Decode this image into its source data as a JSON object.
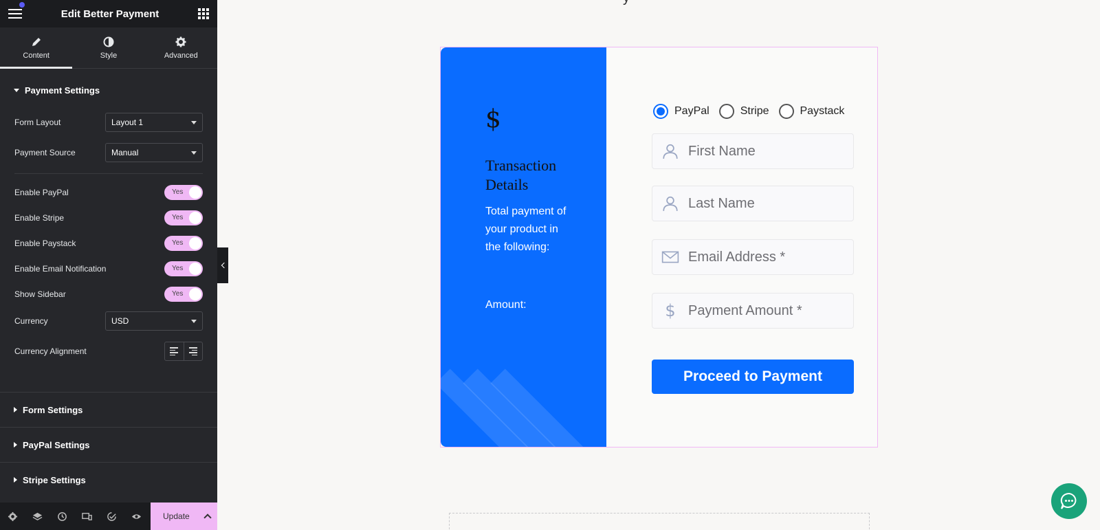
{
  "sidebar": {
    "title": "Edit Better Payment",
    "tabs": [
      {
        "label": "Content",
        "icon": "pencil-icon"
      },
      {
        "label": "Style",
        "icon": "half-circle-icon"
      },
      {
        "label": "Advanced",
        "icon": "gear-icon"
      }
    ],
    "payment_settings": {
      "heading": "Payment Settings",
      "form_layout": {
        "label": "Form Layout",
        "value": "Layout 1"
      },
      "payment_source": {
        "label": "Payment Source",
        "value": "Manual"
      },
      "toggles": [
        {
          "label": "Enable PayPal",
          "state": "Yes"
        },
        {
          "label": "Enable Stripe",
          "state": "Yes"
        },
        {
          "label": "Enable Paystack",
          "state": "Yes"
        },
        {
          "label": "Enable Email Notification",
          "state": "Yes"
        },
        {
          "label": "Show Sidebar",
          "state": "Yes"
        }
      ],
      "currency": {
        "label": "Currency",
        "value": "USD"
      },
      "currency_alignment": {
        "label": "Currency Alignment"
      }
    },
    "sections": [
      "Form Settings",
      "PayPal Settings",
      "Stripe Settings"
    ],
    "footer": {
      "icons": [
        "settings-icon",
        "layers-icon",
        "history-icon",
        "responsive-icon",
        "checklist-icon",
        "preview-icon"
      ],
      "update_label": "Update"
    }
  },
  "canvas": {
    "top_char": "y",
    "card": {
      "currency_symbol": "$",
      "title": "Transaction Details",
      "description": "Total payment of your product in the following:",
      "amount_label": "Amount:",
      "payment_methods": [
        "PayPal",
        "Stripe",
        "Paystack"
      ],
      "selected_method": "PayPal",
      "fields": [
        {
          "placeholder": "First Name",
          "icon": "user-icon"
        },
        {
          "placeholder": "Last Name",
          "icon": "user-icon"
        },
        {
          "placeholder": "Email Address *",
          "icon": "envelope-icon"
        },
        {
          "placeholder": "Payment Amount *",
          "icon": "dollar-icon"
        }
      ],
      "button_label": "Proceed to Payment"
    }
  },
  "colors": {
    "accent": "#0a6cff",
    "toggle": "#f0b8f5",
    "sidebar_bg": "#26272b",
    "chat": "#1aa37a"
  }
}
